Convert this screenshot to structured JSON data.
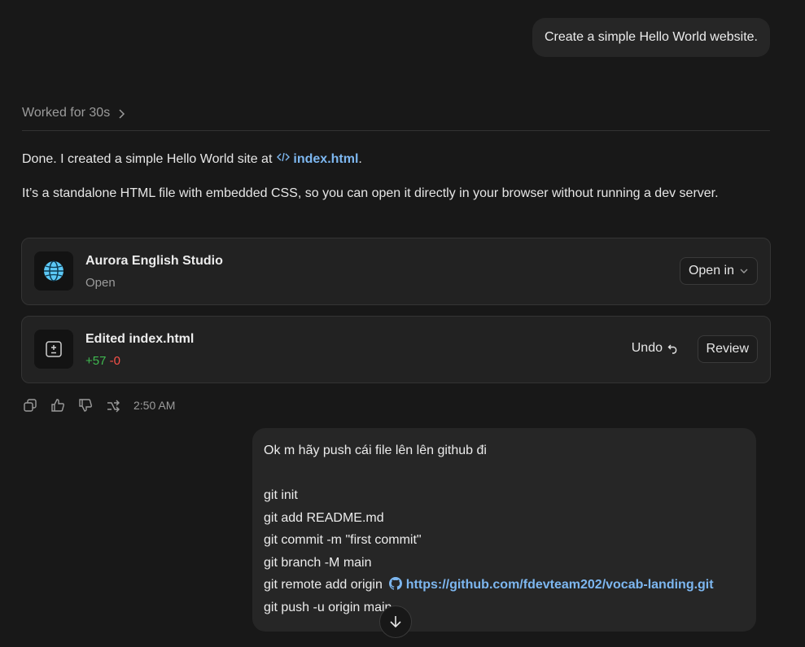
{
  "messages": {
    "user_first": "Create a simple Hello World website.",
    "worked_label": "Worked for 30s",
    "assistant_line1_prefix": "Done. I created a simple Hello World site at",
    "assistant_file_link": "index.html",
    "assistant_line1_suffix": ".",
    "assistant_line2": "It’s a standalone HTML file with embedded CSS, so you can open it directly in your browser without running a dev server."
  },
  "app_card": {
    "title": "Aurora English Studio",
    "subtitle": "Open",
    "open_in_label": "Open in"
  },
  "edit_card": {
    "title": "Edited index.html",
    "additions": "+57",
    "deletions": "-0",
    "undo_label": "Undo",
    "review_label": "Review"
  },
  "actions": {
    "timestamp": "2:50 AM"
  },
  "user_second": {
    "line1": "Ok m hãy push cái file lên lên github đi",
    "line2": "git init",
    "line3": "git add README.md",
    "line4": "git commit -m \"first commit\"",
    "line5": "git branch -M main",
    "line6_prefix": "git remote add origin",
    "line6_link": "https://github.com/fdevteam202/vocab-landing.git",
    "line7": "git push -u origin main"
  },
  "colors": {
    "background": "#181818",
    "link": "#7db7f0",
    "addition": "#3fb950",
    "deletion": "#f85149"
  },
  "icons": [
    "chevron-right-icon",
    "code-icon",
    "globe-icon",
    "diff-icon",
    "chevron-down-icon",
    "undo-icon",
    "copy-icon",
    "thumbs-up-icon",
    "thumbs-down-icon",
    "share-icon",
    "github-icon",
    "arrow-down-icon"
  ]
}
